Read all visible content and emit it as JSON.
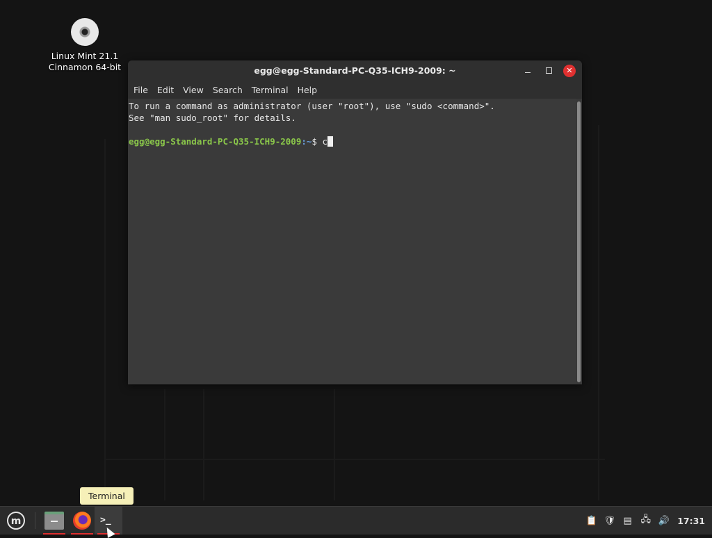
{
  "desktop": {
    "icon": {
      "name": "disc-icon",
      "label_line1": "Linux Mint 21.1",
      "label_line2": "Cinnamon 64-bit"
    }
  },
  "window": {
    "title": "egg@egg-Standard-PC-Q35-ICH9-2009: ~",
    "menu": [
      "File",
      "Edit",
      "View",
      "Search",
      "Terminal",
      "Help"
    ]
  },
  "terminal": {
    "line1": "To run a command as administrator (user \"root\"), use \"sudo <command>\".",
    "line2": "See \"man sudo_root\" for details.",
    "prompt_user": "egg@egg-Standard-PC-Q35-ICH9-2009",
    "prompt_path": ":~",
    "prompt_symbol": "$ ",
    "input": "c"
  },
  "tooltip": {
    "text": "Terminal"
  },
  "taskbar": {
    "clock": "17:31"
  },
  "colors": {
    "prompt_user": "#8ac64a",
    "close_button": "#e03030",
    "running_indicator": "#e03030"
  }
}
